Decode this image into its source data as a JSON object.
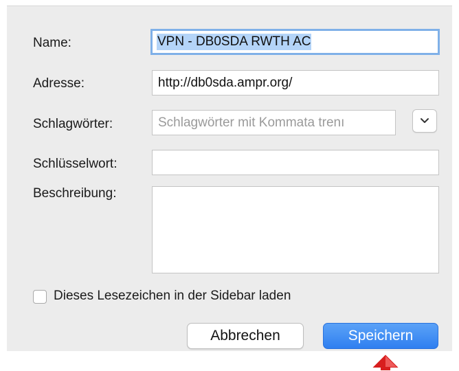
{
  "form": {
    "name_label": "Name:",
    "name_value": "VPN - DB0SDA RWTH AC",
    "address_label": "Adresse:",
    "address_value": "http://db0sda.ampr.org/",
    "tags_label": "Schlagwörter:",
    "tags_placeholder": "Schlagwörter mit Kommata trenı",
    "keyword_label": "Schlüsselwort:",
    "keyword_value": "",
    "description_label": "Beschreibung:",
    "description_value": ""
  },
  "sidebar_checkbox": {
    "label": "Dieses Lesezeichen in der Sidebar laden",
    "checked": false
  },
  "buttons": {
    "cancel_label": "Abbrechen",
    "save_label": "Speichern"
  },
  "colors": {
    "accent": "#2f7ff0",
    "focus_ring": "#7fb0e8",
    "selection": "#b4d4f8",
    "cursor": "#d81e1e"
  },
  "icons": {
    "dropdown": "chevron-down-icon",
    "pointer": "arrow-cursor-icon"
  }
}
